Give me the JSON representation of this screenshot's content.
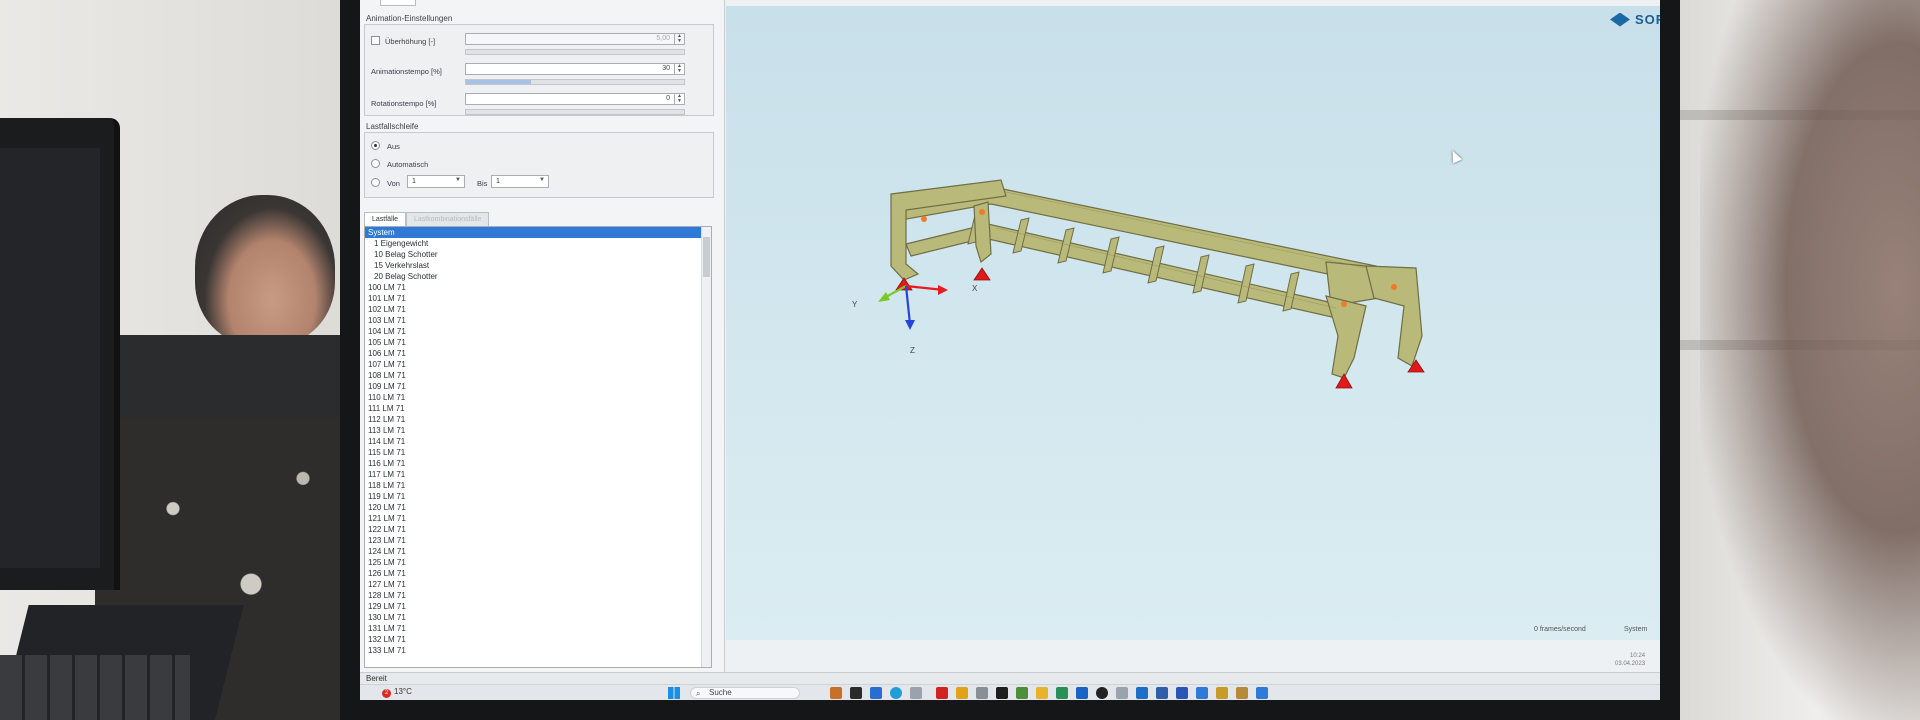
{
  "app": {
    "logo_text": "SOFiSTiK"
  },
  "animation": {
    "group_title": "Animation-Einstellungen",
    "ueberhoehung_label": "Überhöhung [-]",
    "ueberhoehung_value": "5,00",
    "animationstempo_label": "Animationstempo [%]",
    "animationstempo_value": "30",
    "animationstempo_slider_fraction": 0.3,
    "rotationstempo_label": "Rotationstempo [%]",
    "rotationstempo_value": "0"
  },
  "loop": {
    "group_title": "Lastfallschleife",
    "option_aus": "Aus",
    "option_auto": "Automatisch",
    "option_von": "Von",
    "von_value": "1",
    "bis_label": "Bis",
    "bis_value": "1"
  },
  "tabs": {
    "lastfaelle": "Lastfälle",
    "second": "Lastkombinationsfälle"
  },
  "loadcases": {
    "selected": "System",
    "items": [
      "1 Eigengewicht",
      "10 Belag Schotter",
      "15 Verkehrslast",
      "20 Belag Schotter",
      "100 LM 71",
      "101 LM 71",
      "102 LM 71",
      "103 LM 71",
      "104 LM 71",
      "105 LM 71",
      "106 LM 71",
      "107 LM 71",
      "108 LM 71",
      "109 LM 71",
      "110 LM 71",
      "111 LM 71",
      "112 LM 71",
      "113 LM 71",
      "114 LM 71",
      "115 LM 71",
      "116 LM 71",
      "117 LM 71",
      "118 LM 71",
      "119 LM 71",
      "120 LM 71",
      "121 LM 71",
      "122 LM 71",
      "123 LM 71",
      "124 LM 71",
      "125 LM 71",
      "126 LM 71",
      "127 LM 71",
      "128 LM 71",
      "129 LM 71",
      "130 LM 71",
      "131 LM 71",
      "132 LM 71",
      "133 LM 71"
    ]
  },
  "viewport": {
    "axis_x": "X",
    "axis_y": "Y",
    "axis_z": "Z",
    "fps": "0 frames/second",
    "mode": "System",
    "model_color": "#b9b97a",
    "background_color": "#cfe5ed"
  },
  "statusbar": {
    "text": "Bereit"
  },
  "taskbar": {
    "search": "Suche",
    "weather_badge": "2",
    "temperature": "13°C"
  },
  "clock": {
    "time": "10:24",
    "date": "03.04.2023"
  }
}
